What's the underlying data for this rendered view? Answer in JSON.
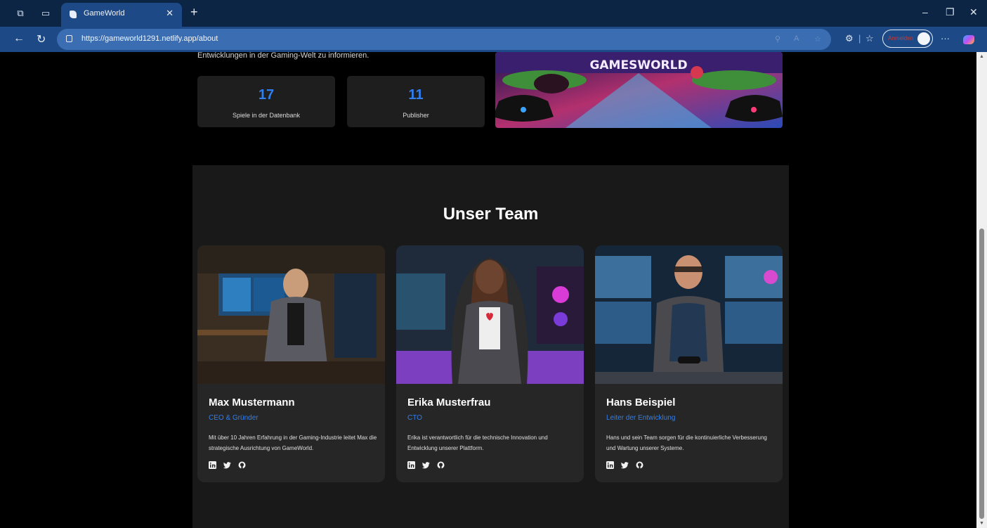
{
  "browser": {
    "tab_title": "GameWorld",
    "url": "https://gameworld1291.netlify.app/about",
    "profile_label": "Anmelden",
    "icons": [
      "workspaces-icon",
      "tab-actions-icon",
      "back-icon",
      "refresh-icon",
      "lock-icon",
      "zoom-icon",
      "read-aloud-icon",
      "favorite-star-icon",
      "extensions-icon",
      "favorites-icon",
      "more-icon",
      "copilot-icon"
    ]
  },
  "about": {
    "intro_text": "Entwicklungen in der Gaming-Welt zu informieren.",
    "stats": [
      {
        "value": "17",
        "label": "Spiele in der Datenbank"
      },
      {
        "value": "11",
        "label": "Publisher"
      }
    ],
    "banner_text": "GAMESWORLD"
  },
  "team": {
    "title": "Unser Team",
    "members": [
      {
        "name": "Max Mustermann",
        "role": "CEO & Gründer",
        "bio": "Mit über 10 Jahren Erfahrung in der Gaming-Industrie leitet Max die strategische Ausrichtung von GameWorld."
      },
      {
        "name": "Erika Musterfrau",
        "role": "CTO",
        "bio": "Erika ist verantwortlich für die technische Innovation und Entwicklung unserer Plattform."
      },
      {
        "name": "Hans Beispiel",
        "role": "Leiter der Entwicklung",
        "bio": "Hans und sein Team sorgen für die kontinuierliche Verbesserung und Wartung unserer Systeme."
      }
    ]
  },
  "colors": {
    "accent": "#2f7ff0",
    "card_bg": "#262626",
    "section_bg": "#191919",
    "tabbar": "#0d2545",
    "navbar": "#1d4a86"
  }
}
